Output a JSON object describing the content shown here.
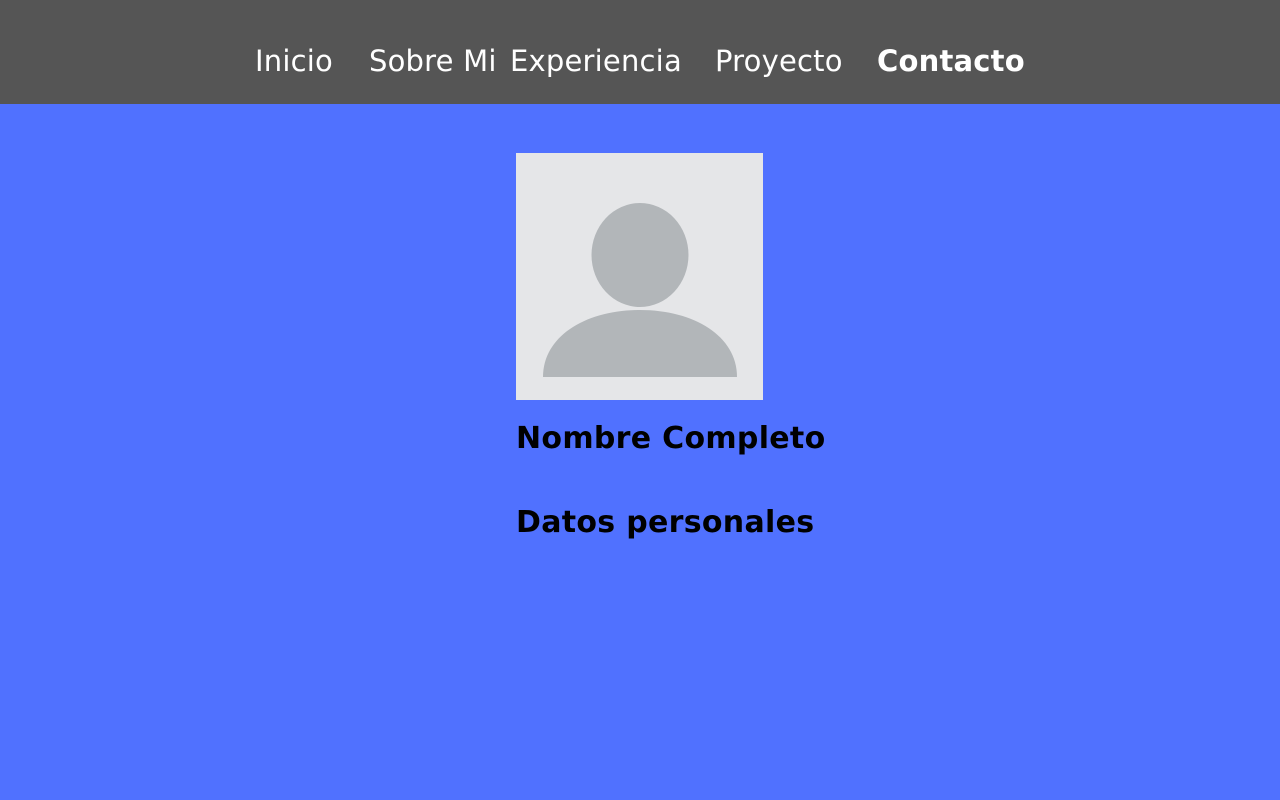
{
  "nav": {
    "items": [
      {
        "label": "Inicio",
        "active": false
      },
      {
        "label": "Sobre Mi",
        "active": false
      },
      {
        "label": "Experiencia",
        "active": false
      },
      {
        "label": "Proyecto",
        "active": false
      },
      {
        "label": "Contacto",
        "active": true
      }
    ]
  },
  "profile": {
    "avatar_icon": "user-placeholder-icon",
    "name": "Nombre Completo",
    "section_title": "Datos personales"
  },
  "colors": {
    "nav_background": "#555555",
    "page_background": "#5071ff",
    "avatar_background": "#e5e6e8",
    "avatar_figure": "#b2b6b9",
    "nav_text": "#ffffff",
    "body_text": "#000000"
  }
}
